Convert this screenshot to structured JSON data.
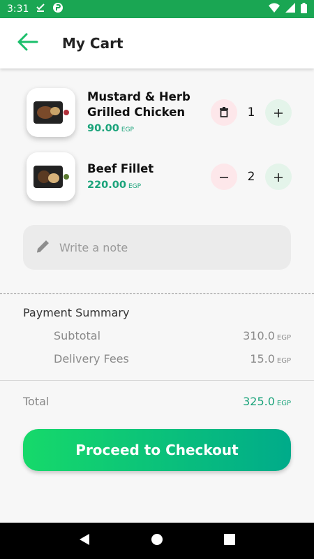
{
  "status_bar": {
    "time": "3:31",
    "background": "#1aa653"
  },
  "app_bar": {
    "title": "My Cart",
    "back_icon": "arrow-left-icon",
    "accent": "#1bbf6b"
  },
  "items": [
    {
      "name": "Mustard & Herb Grilled Chicken",
      "price": "90.00",
      "currency": "EGP",
      "quantity": "1",
      "left_action": "trash-icon",
      "right_action": "plus-icon"
    },
    {
      "name": "Beef Fillet",
      "price": "220.00",
      "currency": "EGP",
      "quantity": "2",
      "left_action": "minus-icon",
      "right_action": "plus-icon"
    }
  ],
  "note": {
    "placeholder": "Write a note",
    "icon": "pencil-icon"
  },
  "summary": {
    "title": "Payment Summary",
    "subtotal_label": "Subtotal",
    "subtotal_value": "310.0",
    "delivery_label": "Delivery Fees",
    "delivery_value": "15.0",
    "currency": "EGP",
    "total_label": "Total",
    "total_value": "325.0"
  },
  "checkout": {
    "label": "Proceed to Checkout"
  }
}
